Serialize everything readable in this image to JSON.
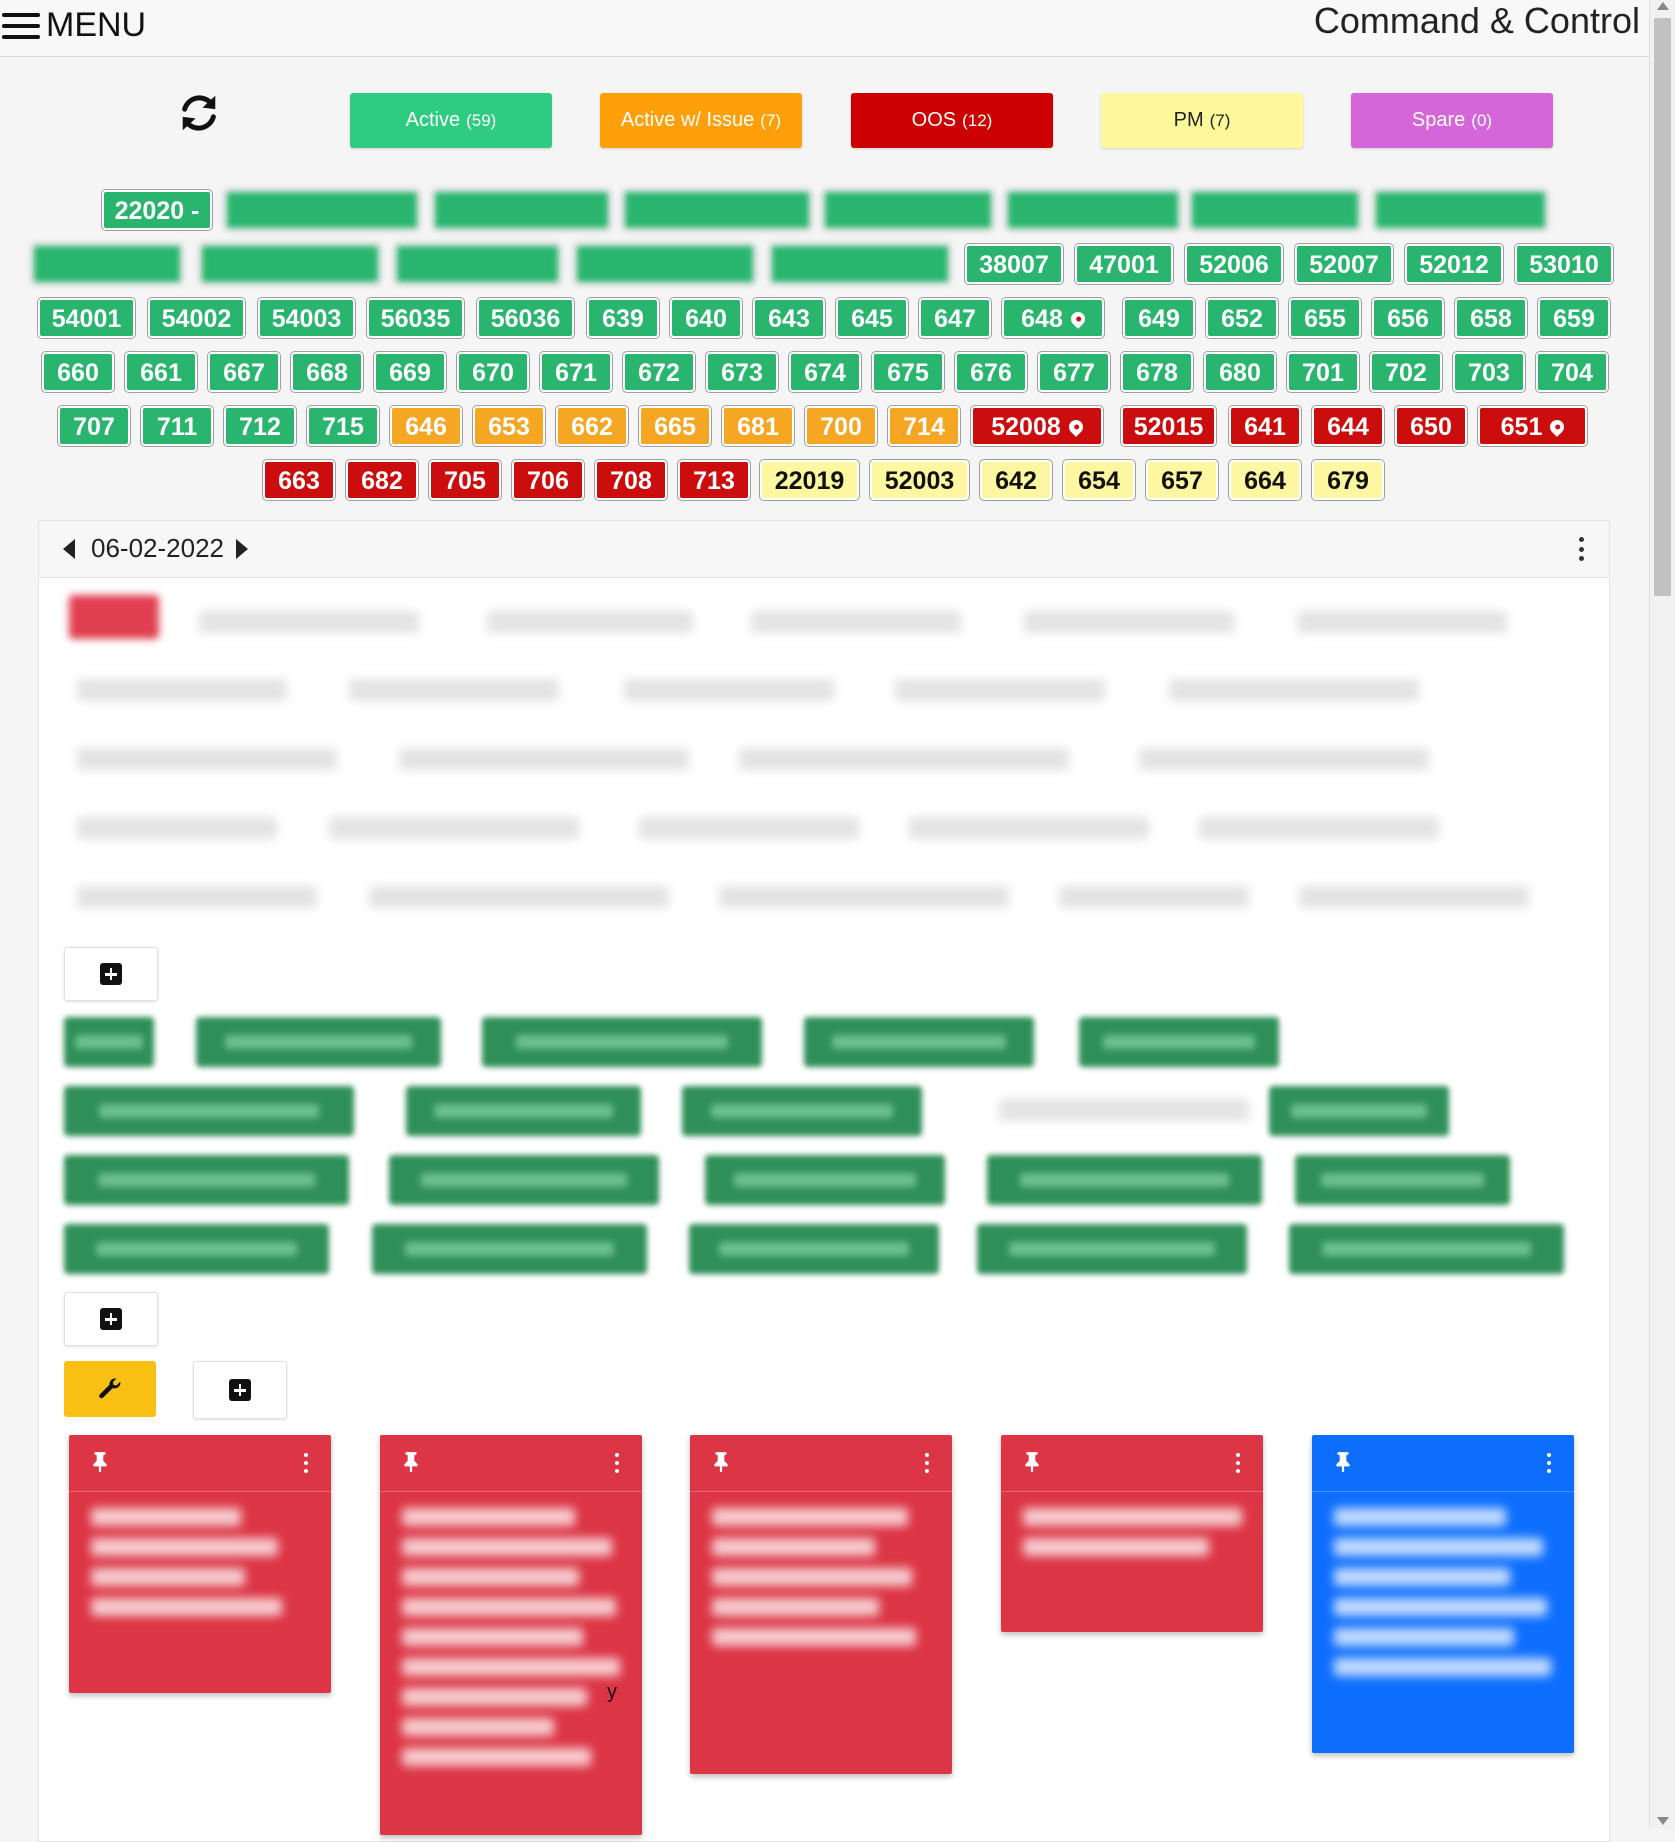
{
  "header": {
    "menu_label": "MENU",
    "app_title": "Command & Control"
  },
  "status_filters": [
    {
      "label": "Active",
      "count": "(59)",
      "color": "#2ecc80"
    },
    {
      "label": "Active w/ Issue",
      "count": "(7)",
      "color": "#ffa00a"
    },
    {
      "label": "OOS",
      "count": "(12)",
      "color": "#cc0000"
    },
    {
      "label": "PM",
      "count": "(7)",
      "color": "#fdf99a"
    },
    {
      "label": "Spare",
      "count": "(0)",
      "color": "#d466d9"
    }
  ],
  "units": {
    "first": "22020 -",
    "row2": [
      "38007",
      "47001",
      "52006",
      "52007",
      "52012",
      "53010"
    ],
    "row3": [
      "54001",
      "54002",
      "54003",
      "56035",
      "56036",
      "639",
      "640",
      "643",
      "645",
      "647",
      "648",
      "649",
      "652",
      "655",
      "656",
      "658",
      "659"
    ],
    "row4": [
      "660",
      "661",
      "667",
      "668",
      "669",
      "670",
      "671",
      "672",
      "673",
      "674",
      "675",
      "676",
      "677",
      "678",
      "680",
      "701",
      "702",
      "703",
      "704"
    ],
    "row5_green": [
      "707",
      "711",
      "712",
      "715"
    ],
    "row5_orange": [
      "646",
      "653",
      "662",
      "665",
      "681",
      "700",
      "714"
    ],
    "row5_red": [
      "52008",
      "52015",
      "641",
      "644",
      "650",
      "651"
    ],
    "row6_red": [
      "663",
      "682",
      "705",
      "706",
      "708",
      "713"
    ],
    "row6_yellow": [
      "22019",
      "52003",
      "642",
      "654",
      "657",
      "664",
      "679"
    ]
  },
  "date_panel": {
    "date": "06-02-2022"
  },
  "note_fragment": "y"
}
